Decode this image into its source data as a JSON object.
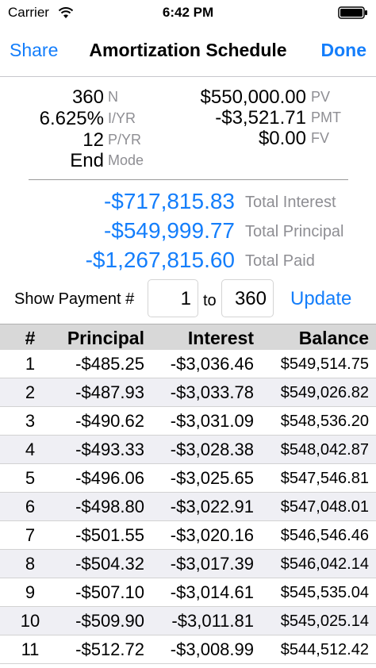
{
  "status": {
    "carrier": "Carrier",
    "time": "6:42 PM"
  },
  "nav": {
    "share": "Share",
    "title": "Amortization Schedule",
    "done": "Done"
  },
  "tvm": {
    "n_value": "360",
    "n_label": "N",
    "iyr_value": "6.625%",
    "iyr_label": "I/YR",
    "pyr_value": "12",
    "pyr_label": "P/YR",
    "mode_value": "End",
    "mode_label": "Mode",
    "pv_value": "$550,000.00",
    "pv_label": "PV",
    "pmt_value": "-$3,521.71",
    "pmt_label": "PMT",
    "fv_value": "$0.00",
    "fv_label": "FV"
  },
  "totals": {
    "interest_value": "-$717,815.83",
    "interest_label": "Total Interest",
    "principal_value": "-$549,999.77",
    "principal_label": "Total Principal",
    "paid_value": "-$1,267,815.60",
    "paid_label": "Total Paid"
  },
  "range": {
    "show_label": "Show Payment #",
    "from": "1",
    "to_label": "to",
    "to": "360",
    "update": "Update"
  },
  "table": {
    "headers": [
      "#",
      "Principal",
      "Interest",
      "Balance"
    ],
    "rows": [
      [
        "1",
        "-$485.25",
        "-$3,036.46",
        "$549,514.75"
      ],
      [
        "2",
        "-$487.93",
        "-$3,033.78",
        "$549,026.82"
      ],
      [
        "3",
        "-$490.62",
        "-$3,031.09",
        "$548,536.20"
      ],
      [
        "4",
        "-$493.33",
        "-$3,028.38",
        "$548,042.87"
      ],
      [
        "5",
        "-$496.06",
        "-$3,025.65",
        "$547,546.81"
      ],
      [
        "6",
        "-$498.80",
        "-$3,022.91",
        "$547,048.01"
      ],
      [
        "7",
        "-$501.55",
        "-$3,020.16",
        "$546,546.46"
      ],
      [
        "8",
        "-$504.32",
        "-$3,017.39",
        "$546,042.14"
      ],
      [
        "9",
        "-$507.10",
        "-$3,014.61",
        "$545,535.04"
      ],
      [
        "10",
        "-$509.90",
        "-$3,011.81",
        "$545,025.14"
      ],
      [
        "11",
        "-$512.72",
        "-$3,008.99",
        "$544,512.42"
      ]
    ]
  },
  "colors": {
    "accent": "#147efb",
    "secondary_text": "#8e8e93",
    "header_bg": "#d8d8d8",
    "alt_row_bg": "#efeff4"
  }
}
